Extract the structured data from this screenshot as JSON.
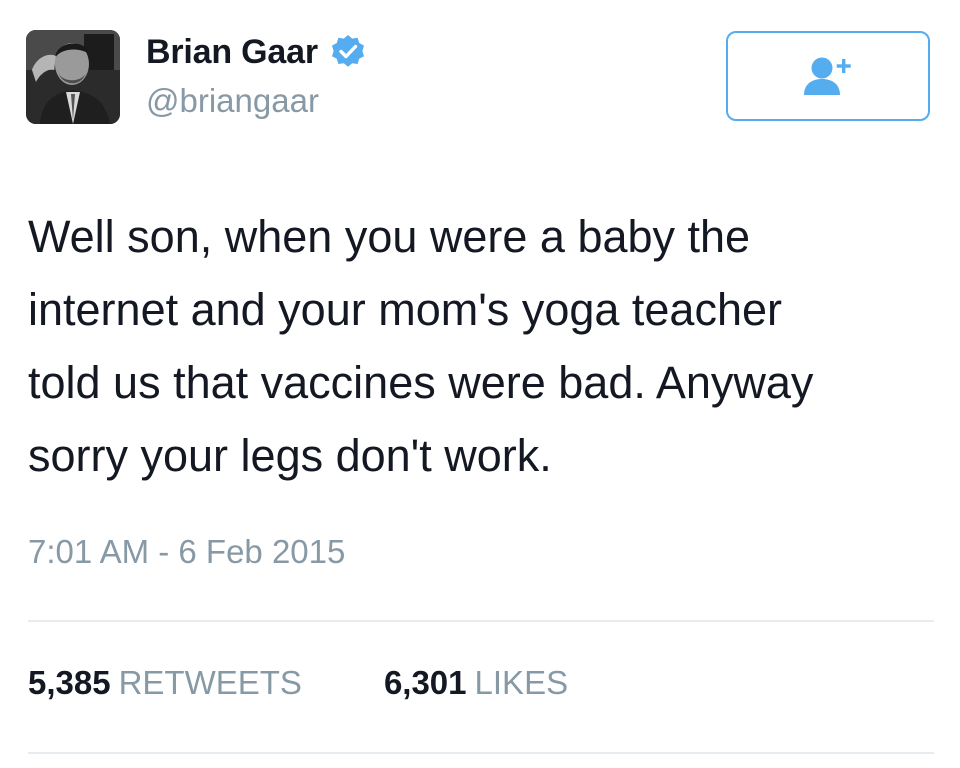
{
  "author": {
    "display_name": "Brian Gaar",
    "handle": "@briangaar",
    "verified": true,
    "avatar_icon": "profile-photo"
  },
  "follow_button": {
    "icon": "add-user-icon",
    "accent_color": "#55acee"
  },
  "tweet": {
    "text": "Well son, when you were a baby the\ninternet and your mom's yoga teacher\ntold us that vaccines were bad. Anyway\nsorry your legs don't work.",
    "timestamp": "7:01 AM - 6 Feb 2015"
  },
  "stats": {
    "retweets": {
      "count": "5,385",
      "label": "RETWEETS"
    },
    "likes": {
      "count": "6,301",
      "label": "LIKES"
    }
  },
  "colors": {
    "text": "#141823",
    "muted": "#8899a6",
    "accent": "#55acee",
    "divider": "#e6ecf0"
  }
}
